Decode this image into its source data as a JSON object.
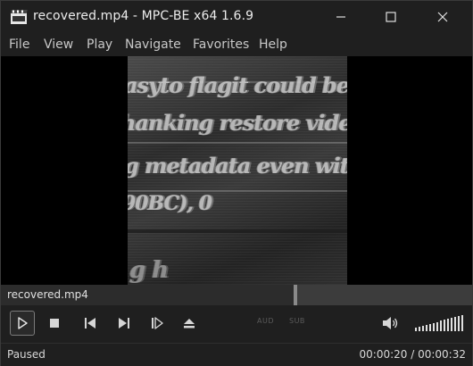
{
  "window": {
    "title": "recovered.mp4 - MPC-BE x64 1.6.9",
    "app_icon": "mpc-be-film-icon"
  },
  "menu": [
    "File",
    "View",
    "Play",
    "Navigate",
    "Favorites",
    "Help"
  ],
  "video_frame_text": [
    "asyto    flagit could be e",
    "hanking restore video with",
    "g metadata      even withou",
    "90BC),                  0",
    "",
    "g    h                   "
  ],
  "seek": {
    "filename": "recovered.mp4",
    "progress_fraction": 0.625
  },
  "controls": {
    "aud_label": "AUD",
    "sub_label": "SUB",
    "volume_icon": "speaker-icon"
  },
  "status": {
    "state": "Paused",
    "time": "00:00:20 / 00:00:32"
  },
  "colors": {
    "background": "#1f1f1f",
    "seek_track": "#3c3c3c",
    "seek_fill": "#2c2c2c"
  }
}
